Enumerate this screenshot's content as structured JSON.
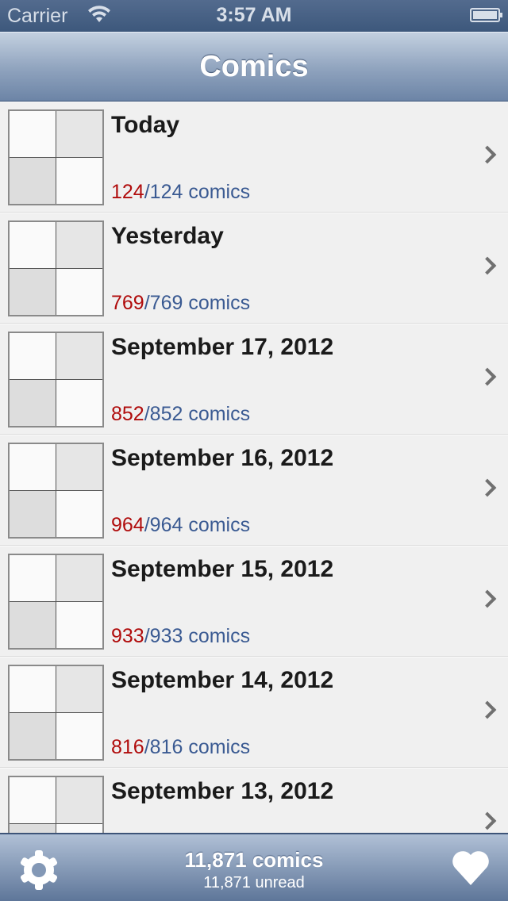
{
  "status_bar": {
    "carrier": "Carrier",
    "time": "3:57 AM",
    "wifi_icon": "wifi-icon",
    "battery_icon": "battery-icon"
  },
  "nav": {
    "title": "Comics"
  },
  "rows": [
    {
      "title": "Today",
      "read": "124",
      "total": "/124 comics"
    },
    {
      "title": "Yesterday",
      "read": "769",
      "total": "/769 comics"
    },
    {
      "title": "September 17, 2012",
      "read": "852",
      "total": "/852 comics"
    },
    {
      "title": "September 16, 2012",
      "read": "964",
      "total": "/964 comics"
    },
    {
      "title": "September 15, 2012",
      "read": "933",
      "total": "/933 comics"
    },
    {
      "title": "September 14, 2012",
      "read": "816",
      "total": "/816 comics"
    },
    {
      "title": "September 13, 2012",
      "read": "",
      "total": ""
    }
  ],
  "toolbar": {
    "comics": "11,871 comics",
    "unread": "11,871 unread",
    "settings_icon": "gear-icon",
    "favorites_icon": "heart-icon"
  },
  "colors": {
    "read": "#b00c0c",
    "total": "#3a5a92",
    "nav": "#6c84a6"
  }
}
